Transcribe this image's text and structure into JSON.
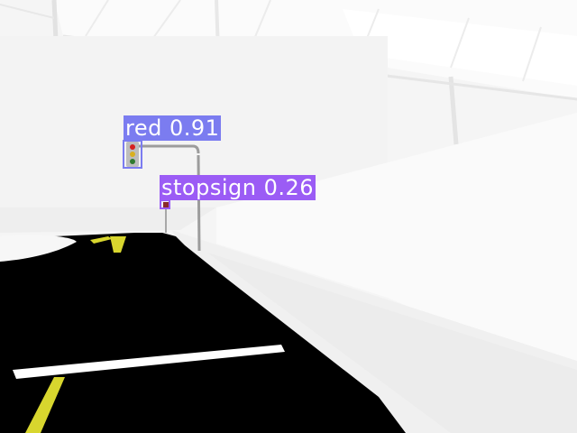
{
  "detections": [
    {
      "label": "red",
      "score": "0.91",
      "color": "#7b7cf0"
    },
    {
      "label": "stopsign",
      "score": "0.26",
      "color": "#9b5cf5"
    }
  ],
  "colors": {
    "road": "#000000",
    "lane_line": "#d8d62e",
    "stop_line": "#ffffff",
    "walls": "#f4f4f4"
  }
}
